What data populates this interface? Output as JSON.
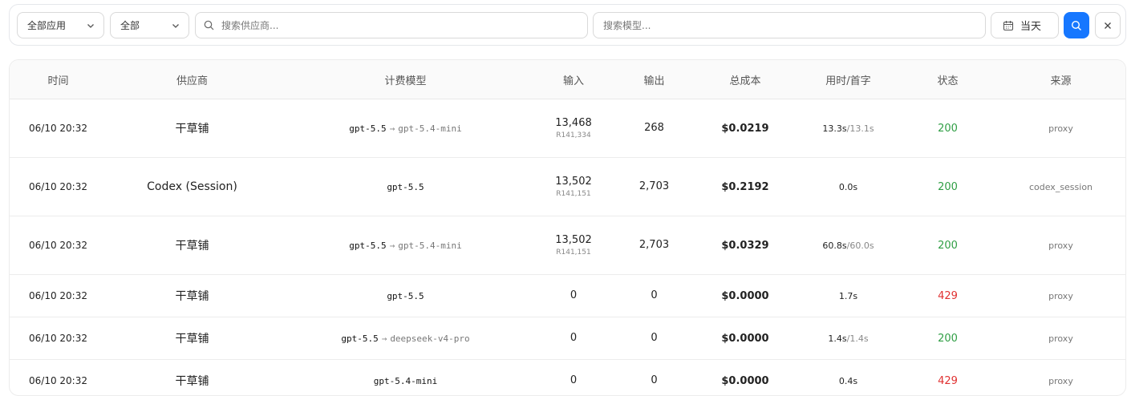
{
  "filters": {
    "app_select": "全部应用",
    "status_select": "全部",
    "provider_search_placeholder": "搜索供应商...",
    "model_search_placeholder": "搜索模型...",
    "date_label": "当天"
  },
  "table": {
    "headers": [
      "时间",
      "供应商",
      "计费模型",
      "输入",
      "输出",
      "总成本",
      "用时/首字",
      "状态",
      "来源"
    ],
    "rows": [
      {
        "time": "06/10 20:32",
        "provider": "干草铺",
        "model": "gpt-5.5",
        "model_arrow": "→",
        "model_alt": "gpt-5.4-mini",
        "input": "13,468",
        "input_sub": "R141,334",
        "output": "268",
        "cost": "$0.0219",
        "duration": "13.3s",
        "first": "/13.1s",
        "status": "200",
        "source": "proxy"
      },
      {
        "time": "06/10 20:32",
        "provider": "Codex (Session)",
        "model": "gpt-5.5",
        "model_arrow": "",
        "model_alt": "",
        "input": "13,502",
        "input_sub": "R141,151",
        "output": "2,703",
        "cost": "$0.2192",
        "duration": "0.0s",
        "first": "",
        "status": "200",
        "source": "codex_session"
      },
      {
        "time": "06/10 20:32",
        "provider": "干草铺",
        "model": "gpt-5.5",
        "model_arrow": "→",
        "model_alt": "gpt-5.4-mini",
        "input": "13,502",
        "input_sub": "R141,151",
        "output": "2,703",
        "cost": "$0.0329",
        "duration": "60.8s",
        "first": "/60.0s",
        "status": "200",
        "source": "proxy"
      },
      {
        "time": "06/10 20:32",
        "provider": "干草铺",
        "model": "gpt-5.5",
        "model_arrow": "",
        "model_alt": "",
        "input": "0",
        "input_sub": "",
        "output": "0",
        "cost": "$0.0000",
        "duration": "1.7s",
        "first": "",
        "status": "429",
        "source": "proxy"
      },
      {
        "time": "06/10 20:32",
        "provider": "干草铺",
        "model": "gpt-5.5",
        "model_arrow": "→",
        "model_alt": "deepseek-v4-pro",
        "input": "0",
        "input_sub": "",
        "output": "0",
        "cost": "$0.0000",
        "duration": "1.4s",
        "first": "/1.4s",
        "status": "200",
        "source": "proxy"
      },
      {
        "time": "06/10 20:32",
        "provider": "干草铺",
        "model": "gpt-5.4-mini",
        "model_arrow": "",
        "model_alt": "",
        "input": "0",
        "input_sub": "",
        "output": "0",
        "cost": "$0.0000",
        "duration": "0.4s",
        "first": "",
        "status": "429",
        "source": "proxy"
      }
    ]
  },
  "colors": {
    "accent": "#1677ff",
    "success": "#2f9e44",
    "error": "#e03131"
  },
  "icons": {
    "dropdown": "chevron-down-icon",
    "search": "search-icon",
    "calendar": "calendar-icon",
    "clear": "close-icon"
  }
}
